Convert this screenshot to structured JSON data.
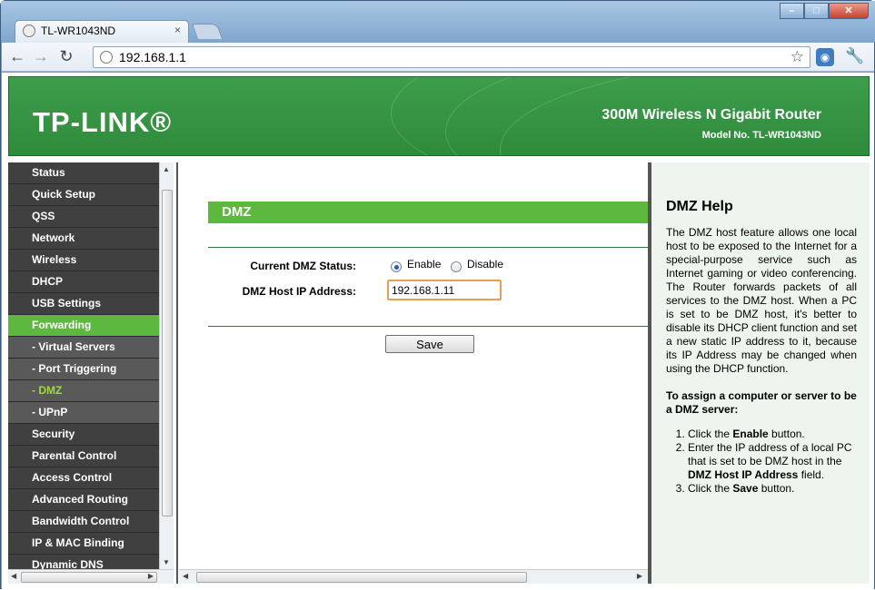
{
  "browser": {
    "tab_title": "TL-WR1043ND",
    "tab_close": "×",
    "url": "192.168.1.1",
    "controls": {
      "minimize": "–",
      "maximize": "□",
      "close": "✕"
    }
  },
  "banner": {
    "logo": "TP-LINK®",
    "product": "300M Wireless N Gigabit Router",
    "model": "Model No. TL-WR1043ND"
  },
  "sidebar": {
    "items": [
      {
        "label": "Status",
        "type": "main"
      },
      {
        "label": "Quick Setup",
        "type": "main"
      },
      {
        "label": "QSS",
        "type": "main"
      },
      {
        "label": "Network",
        "type": "main"
      },
      {
        "label": "Wireless",
        "type": "main"
      },
      {
        "label": "DHCP",
        "type": "main"
      },
      {
        "label": "USB Settings",
        "type": "main"
      },
      {
        "label": "Forwarding",
        "type": "active"
      },
      {
        "label": "- Virtual Servers",
        "type": "sub"
      },
      {
        "label": "- Port Triggering",
        "type": "sub"
      },
      {
        "label": "- DMZ",
        "type": "current"
      },
      {
        "label": "- UPnP",
        "type": "sub"
      },
      {
        "label": "Security",
        "type": "main"
      },
      {
        "label": "Parental Control",
        "type": "main"
      },
      {
        "label": "Access Control",
        "type": "main"
      },
      {
        "label": "Advanced Routing",
        "type": "main"
      },
      {
        "label": "Bandwidth Control",
        "type": "main"
      },
      {
        "label": "IP & MAC Binding",
        "type": "main"
      },
      {
        "label": "Dynamic DNS",
        "type": "main"
      }
    ]
  },
  "main": {
    "header": "DMZ",
    "status_label": "Current DMZ Status:",
    "enable_label": "Enable",
    "disable_label": "Disable",
    "selected_status": "Enable",
    "ip_label": "DMZ Host IP Address:",
    "ip_value": "192.168.1.11",
    "save_label": "Save"
  },
  "help": {
    "title": "DMZ Help",
    "body": "The DMZ host feature allows one local host to be exposed to the Internet for a special-purpose service such as Internet gaming or video conferencing. The Router forwards packets of all services to the DMZ host. When a PC is set to be DMZ host, it's better to disable its DHCP client function and set a new static IP address to it, because its IP Address may be changed when using the DHCP function.",
    "subtitle": "To assign a computer or server to be a DMZ server:",
    "step1_pre": "Click the ",
    "step1_bold": "Enable",
    "step1_post": " button.",
    "step2_pre": "Enter the IP address of a local PC that is set to be DMZ host in the ",
    "step2_bold": "DMZ Host IP Address",
    "step2_post": " field.",
    "step3_pre": "Click the ",
    "step3_bold": "Save",
    "step3_post": " button."
  },
  "colors": {
    "accent_green": "#5db840",
    "banner_green": "#2f8b3c",
    "menu_dark": "#404040"
  }
}
